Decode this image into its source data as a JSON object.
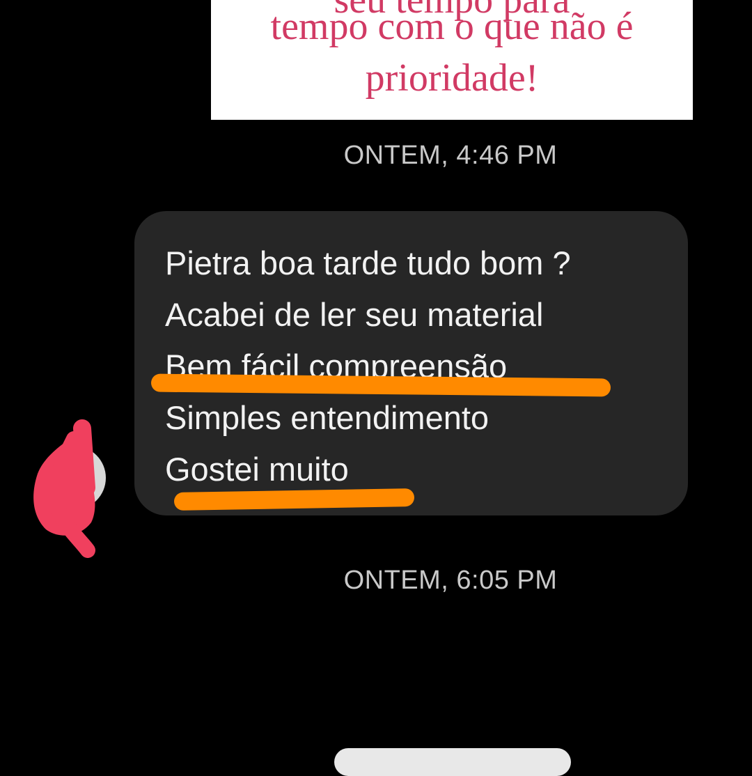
{
  "shared_post": {
    "line_clipped": "seu tempo para",
    "line1": "tempo com o que não é",
    "line2": "prioridade!",
    "text_color": "#d13a64",
    "background": "#ffffff"
  },
  "timestamps": {
    "first": "ONTEM, 4:46 PM",
    "second": "ONTEM, 6:05 PM"
  },
  "message": {
    "lines": [
      "Pietra boa tarde tudo bom ?",
      "Acabei de ler seu material",
      "Bem fácil compreensão",
      "Simples entendimento",
      "Gostei muito"
    ],
    "bubble_color": "#262626",
    "highlight_color": "#ff8a00"
  },
  "avatar": {
    "icon": "avatar-icon",
    "redaction_color": "#f0405e"
  }
}
